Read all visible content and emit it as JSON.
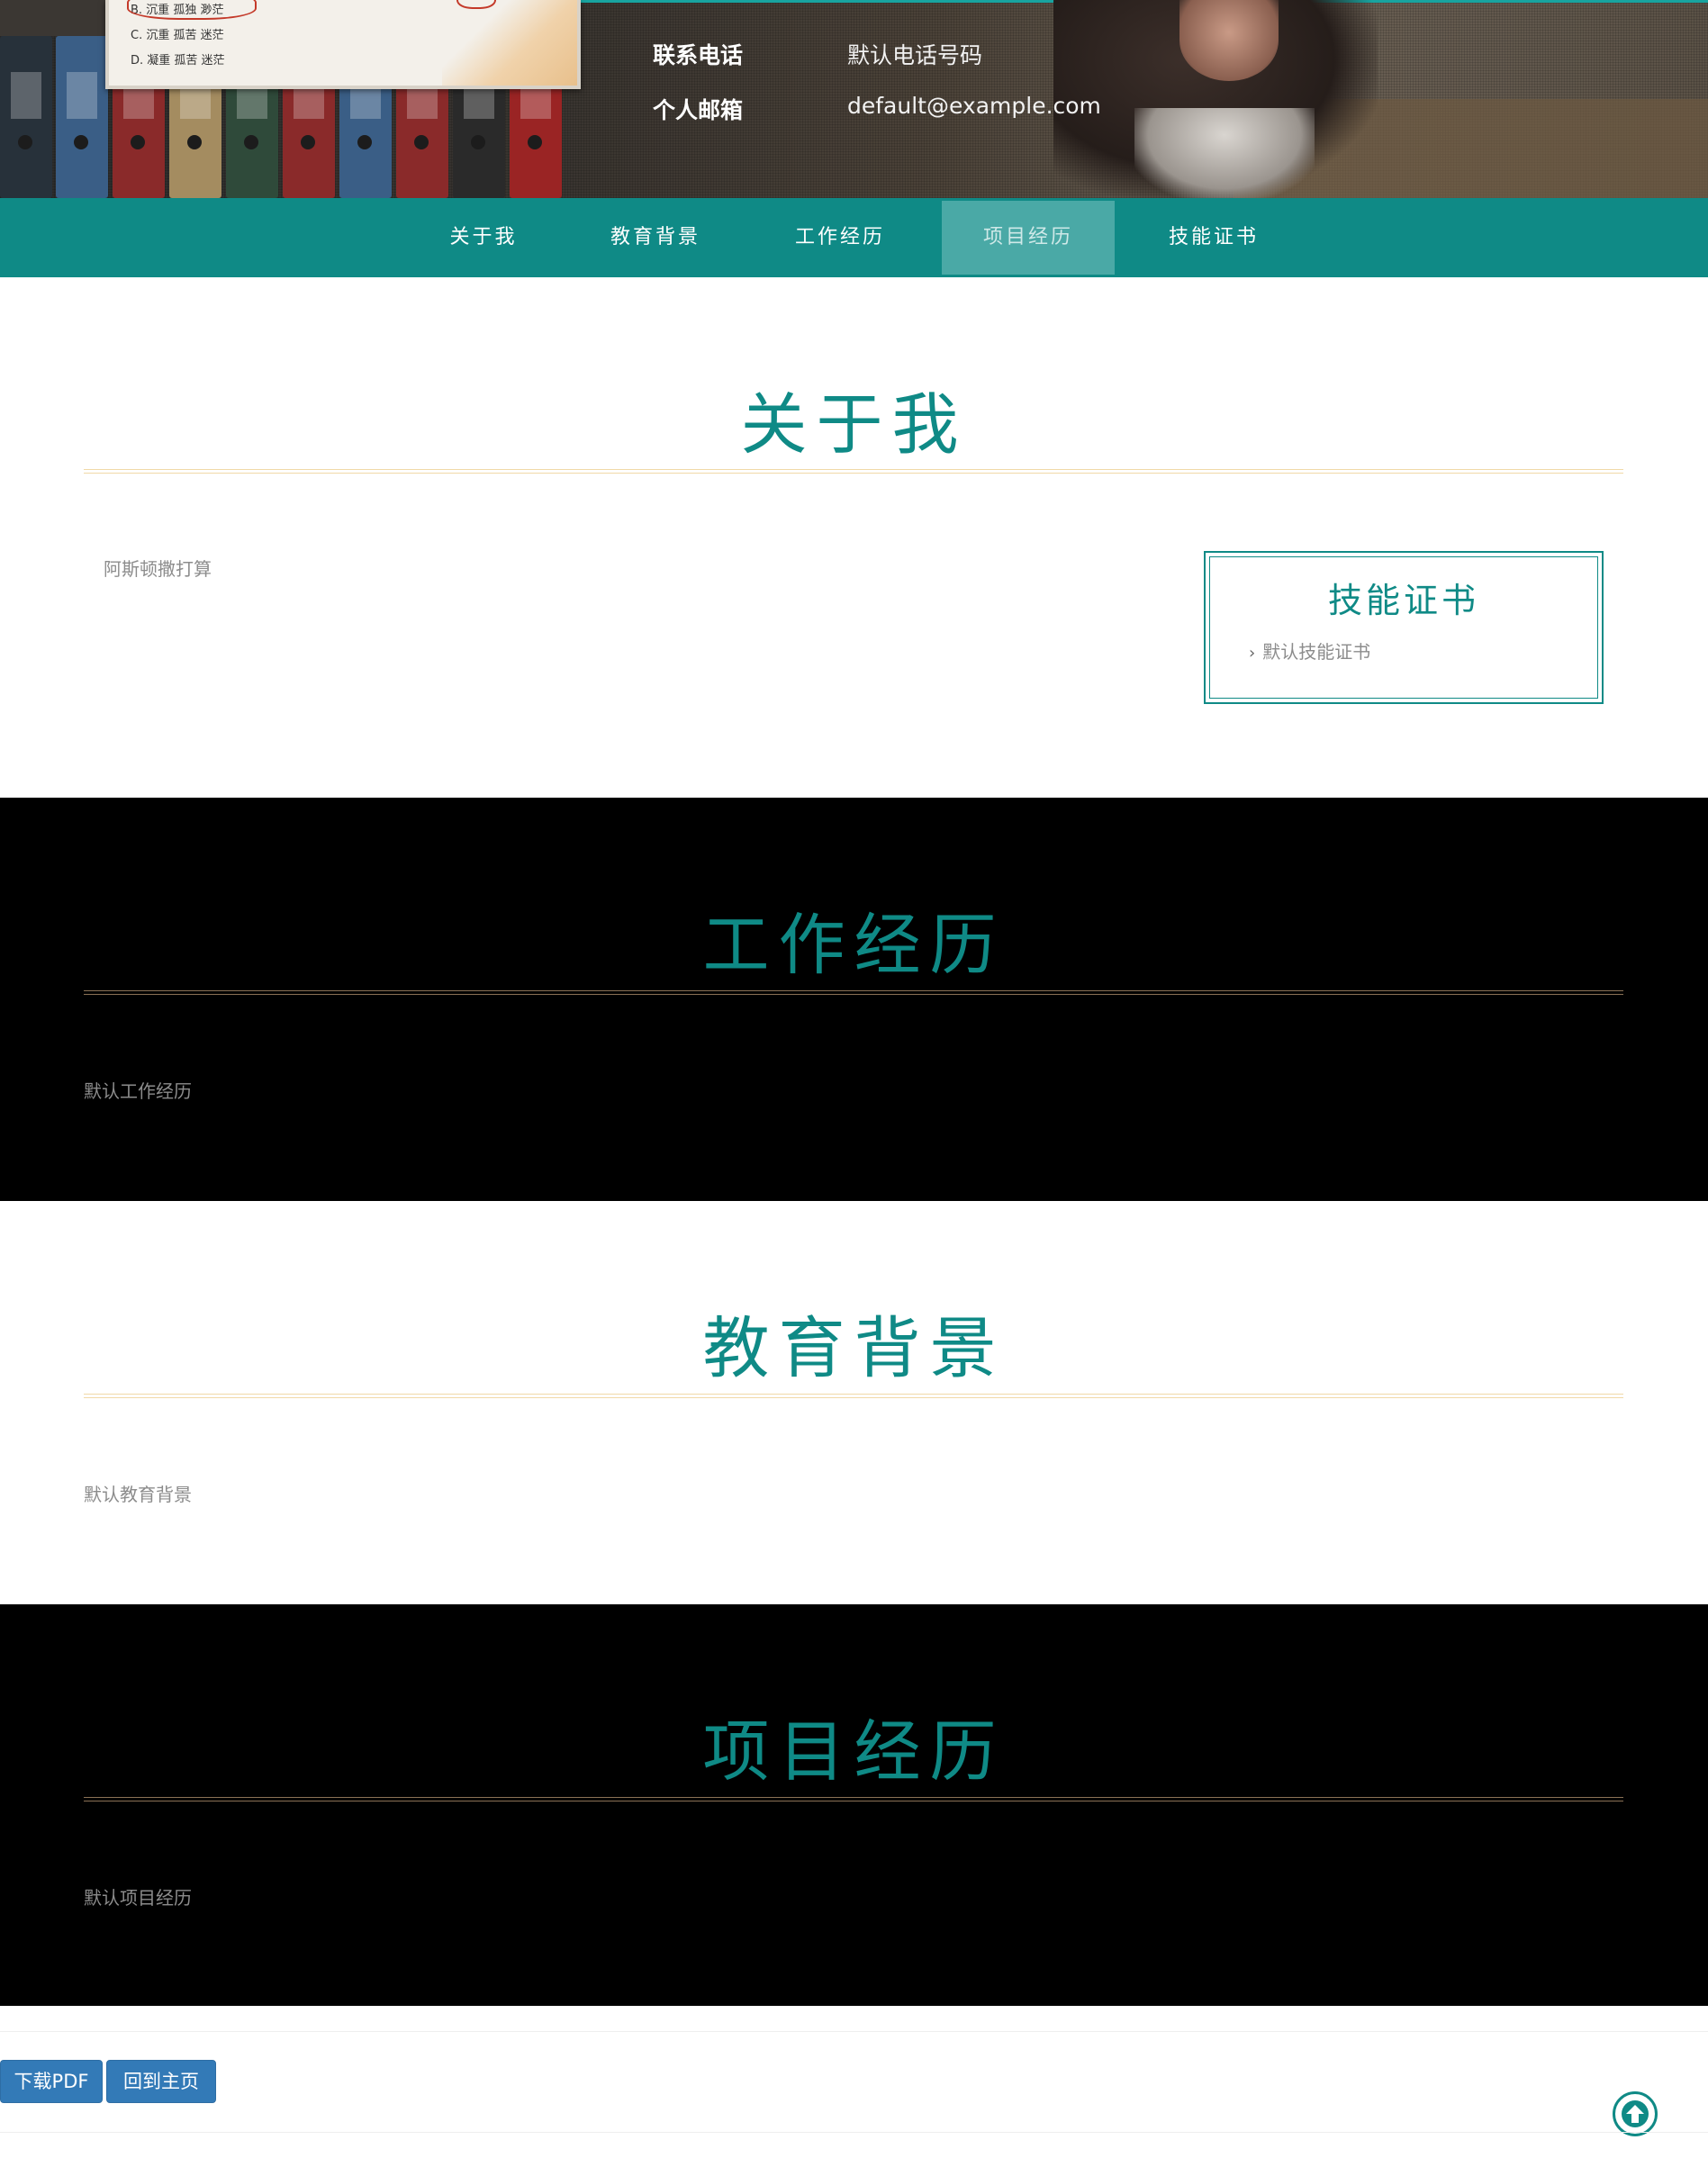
{
  "header": {
    "photo_options": [
      "B. 沉重 孤独 渺茫",
      "C. 沉重 孤苦 迷茫",
      "D. 凝重 孤苦 迷茫"
    ],
    "contacts": [
      {
        "label": "联系电话",
        "value": "默认电话号码"
      },
      {
        "label": "个人邮箱",
        "value": "default@example.com"
      }
    ]
  },
  "nav": {
    "items": [
      {
        "label": "关于我",
        "active": false
      },
      {
        "label": "教育背景",
        "active": false
      },
      {
        "label": "工作经历",
        "active": false
      },
      {
        "label": "项目经历",
        "active": true
      },
      {
        "label": "技能证书",
        "active": false
      }
    ]
  },
  "about": {
    "title": "关于我",
    "text": "阿斯顿撒打算",
    "cert_box": {
      "title": "技能证书",
      "items": [
        "默认技能证书"
      ]
    }
  },
  "work": {
    "title": "工作经历",
    "text": "默认工作经历"
  },
  "education": {
    "title": "教育背景",
    "text": "默认教育背景"
  },
  "projects": {
    "title": "项目经历",
    "text": "默认项目经历"
  },
  "footer": {
    "download_pdf": "下载PDF",
    "back_home": "回到主页",
    "icons": [
      "arrow-up-circle-icon"
    ]
  },
  "colors": {
    "accent": "#0f8a86",
    "nav_active": "#4aa9a6",
    "button": "#337ab7",
    "rule": "#f1d9a8"
  }
}
